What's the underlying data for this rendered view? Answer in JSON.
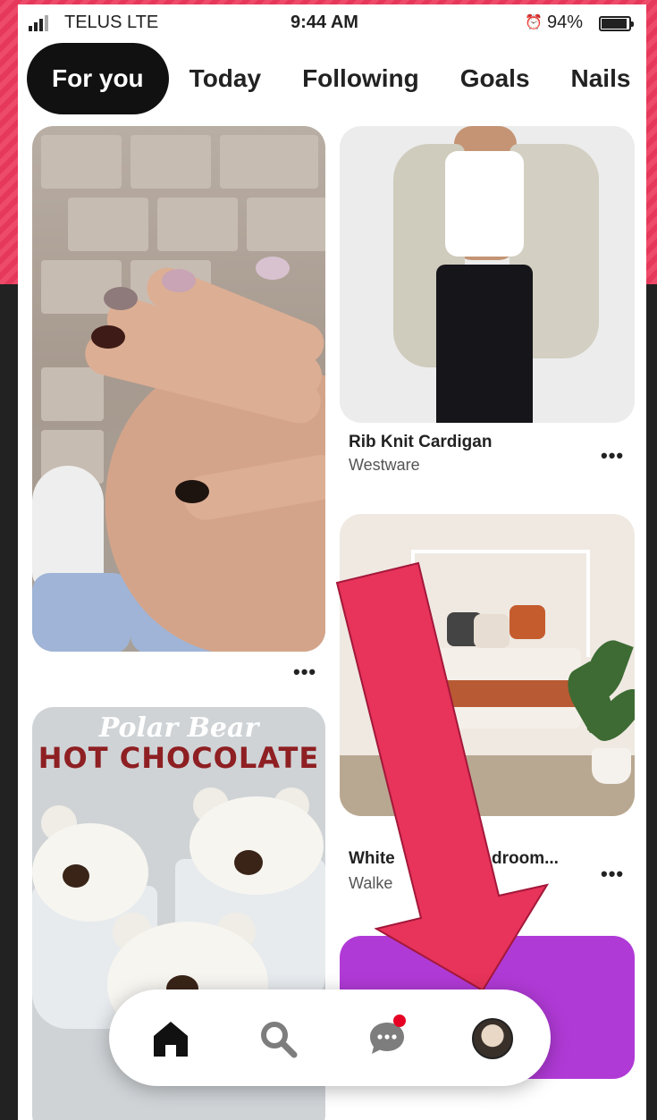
{
  "status_bar": {
    "carrier": "TELUS  LTE",
    "time": "9:44 AM",
    "battery_text": "94%",
    "battery_level": 0.94
  },
  "tabs": [
    {
      "label": "For you",
      "active": true
    },
    {
      "label": "Today",
      "active": false
    },
    {
      "label": "Following",
      "active": false
    },
    {
      "label": "Goals",
      "active": false
    },
    {
      "label": "Nails",
      "active": false
    }
  ],
  "pins": {
    "nails": {
      "more": "•••"
    },
    "cardigan": {
      "title": "Rib Knit Cardigan",
      "subtitle": "Westware",
      "more": "•••"
    },
    "bedroom": {
      "title_left": "White",
      "title_right": "droom...",
      "subtitle": "Walke",
      "more": "•••"
    },
    "cocoa": {
      "title_line1": "Polar Bear",
      "title_line2": "HOT CHOCOLATE"
    },
    "purple": {}
  },
  "nav": {
    "items": [
      {
        "icon": "home-icon",
        "active": true
      },
      {
        "icon": "search-icon",
        "active": false
      },
      {
        "icon": "chat-icon",
        "active": false,
        "has_notification": true
      },
      {
        "icon": "profile-avatar",
        "active": false
      }
    ]
  },
  "colors": {
    "accent_red": "#e60023",
    "annotation_arrow": "#e8335a",
    "background_stripe": "#e5385a"
  }
}
